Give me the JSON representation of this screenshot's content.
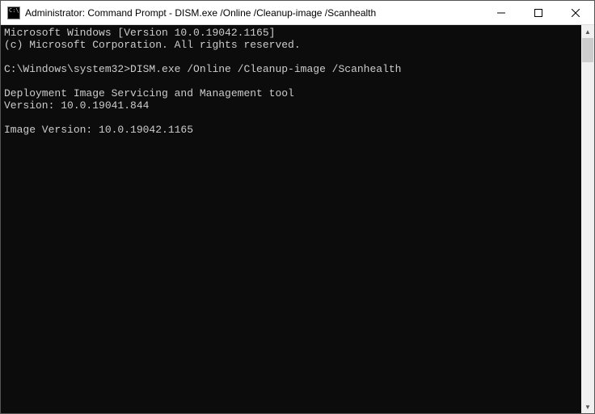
{
  "titlebar": {
    "title": "Administrator: Command Prompt - DISM.exe  /Online /Cleanup-image /Scanhealth"
  },
  "console": {
    "line1": "Microsoft Windows [Version 10.0.19042.1165]",
    "line2": "(c) Microsoft Corporation. All rights reserved.",
    "blank1": "",
    "prompt_line": "C:\\Windows\\system32>DISM.exe /Online /Cleanup-image /Scanhealth",
    "blank2": "",
    "tool_line": "Deployment Image Servicing and Management tool",
    "version_line": "Version: 10.0.19041.844",
    "blank3": "",
    "image_version_line": "Image Version: 10.0.19042.1165"
  }
}
